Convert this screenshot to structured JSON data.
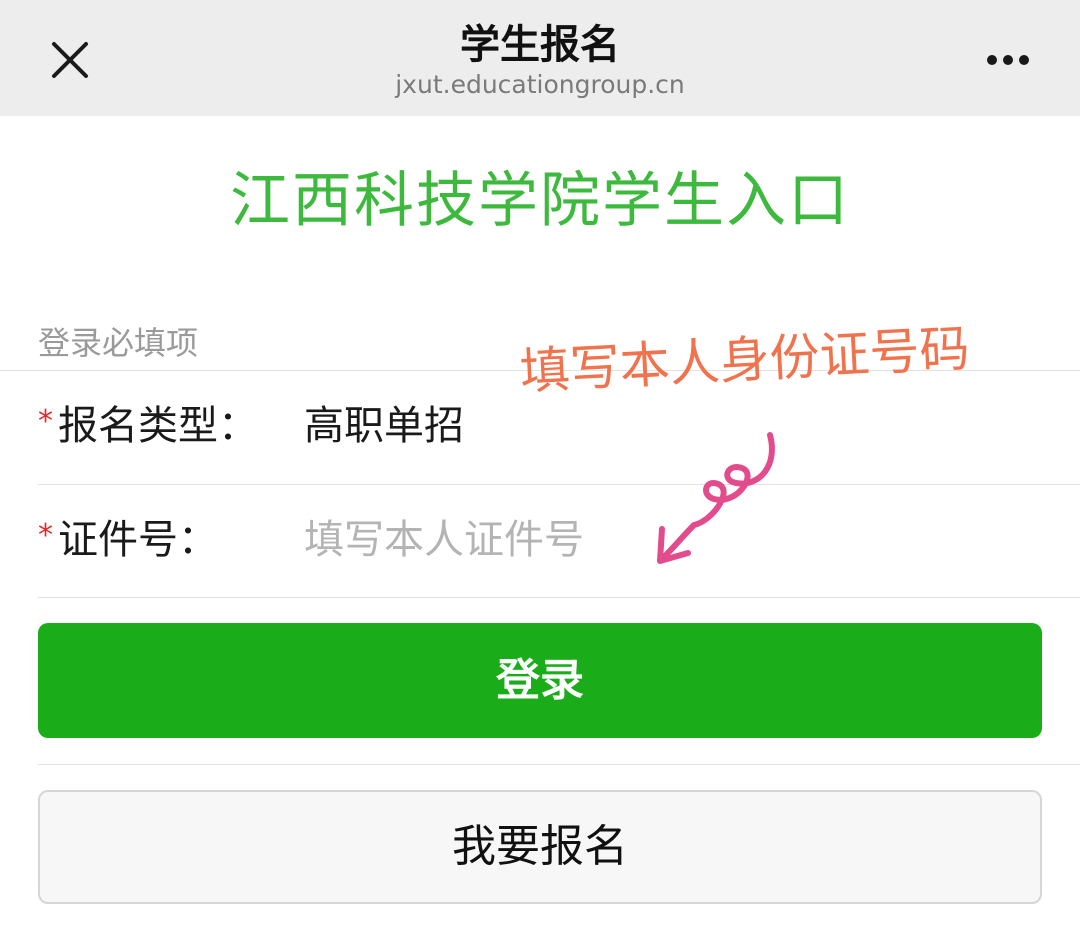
{
  "nav": {
    "title": "学生报名",
    "url": "jxut.educationgroup.cn",
    "close_icon": "close-icon",
    "more_icon": "more-horizontal-icon"
  },
  "page": {
    "heading": "江西科技学院学生入口",
    "heading_color": "#3db93d"
  },
  "form": {
    "section_label": "登录必填项",
    "required_mark": "*",
    "type_label": "报名类型：",
    "type_value": "高职单招",
    "id_label": "证件号：",
    "id_value": "",
    "id_placeholder": "填写本人证件号"
  },
  "annotation": {
    "text": "填写本人身份证号码",
    "color": "#f0734e",
    "arrow_icon": "curly-arrow-icon"
  },
  "buttons": {
    "login_label": "登录",
    "login_color": "#1aad19",
    "register_label": "我要报名"
  }
}
